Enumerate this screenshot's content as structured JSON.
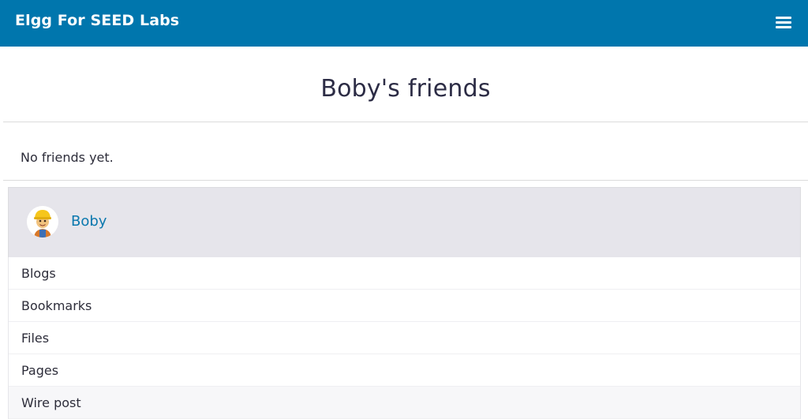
{
  "header": {
    "site_title": "Elgg For SEED Labs",
    "menu_icon": "hamburger-icon",
    "background_color": "#0076ad"
  },
  "page": {
    "title": "Boby's friends",
    "empty_message": "No friends yet."
  },
  "owner": {
    "name": "Boby",
    "avatar_icon": "user-avatar",
    "link_color": "#0a78ae"
  },
  "owner_menu": {
    "items": [
      {
        "label": "Blogs"
      },
      {
        "label": "Bookmarks"
      },
      {
        "label": "Files"
      },
      {
        "label": "Pages"
      },
      {
        "label": "Wire post"
      }
    ]
  }
}
